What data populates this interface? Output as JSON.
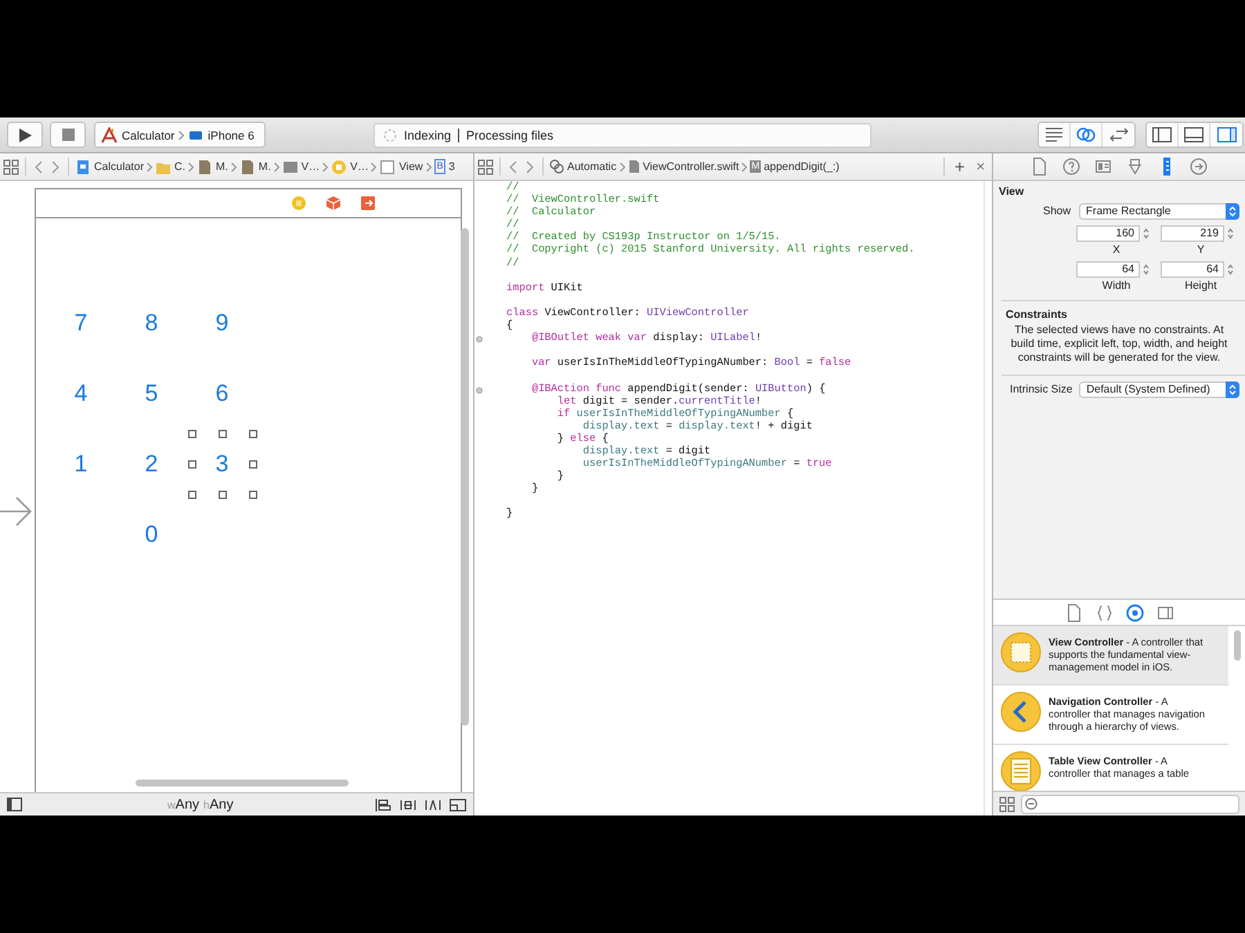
{
  "toolbar": {
    "scheme": {
      "project": "Calculator",
      "device": "iPhone 6"
    },
    "activity": {
      "status": "Indexing",
      "detail": "Processing files"
    },
    "editor_modes": [
      {
        "kind": "standard",
        "selected": false
      },
      {
        "kind": "assistant",
        "selected": true
      },
      {
        "kind": "version",
        "selected": false
      }
    ],
    "panels": [
      {
        "kind": "navigator",
        "on": false
      },
      {
        "kind": "debug",
        "on": false
      },
      {
        "kind": "utilities",
        "on": true
      }
    ]
  },
  "storyboard": {
    "jump_bar": [
      {
        "kind": "project",
        "label": "Calculator"
      },
      {
        "kind": "folder",
        "label": "C."
      },
      {
        "kind": "file",
        "label": "M."
      },
      {
        "kind": "file",
        "label": "M."
      },
      {
        "kind": "scene",
        "label": "V…"
      },
      {
        "kind": "controller",
        "label": "V…"
      },
      {
        "kind": "view",
        "label": "View"
      },
      {
        "kind": "button",
        "badge": "B",
        "label": "3"
      }
    ],
    "keypad": [
      [
        {
          "label": "7",
          "selected": false
        },
        {
          "label": "8",
          "selected": false
        },
        {
          "label": "9",
          "selected": false
        }
      ],
      [
        {
          "label": "4",
          "selected": false
        },
        {
          "label": "5",
          "selected": false
        },
        {
          "label": "6",
          "selected": false
        }
      ],
      [
        {
          "label": "1",
          "selected": false
        },
        {
          "label": "2",
          "selected": false
        },
        {
          "label": "3",
          "selected": true
        }
      ],
      [
        {
          "label": "0",
          "selected": false
        }
      ]
    ],
    "size_class": {
      "width_prefix": "w",
      "width": "Any",
      "height_prefix": "h",
      "height": "Any"
    }
  },
  "editor": {
    "jump_bar": {
      "mode": "Automatic",
      "file": "ViewController.swift",
      "symbol_badge": "M",
      "symbol": "appendDigit(_:)",
      "add": "+",
      "close": "×"
    },
    "lines": [
      {
        "kind": "code",
        "connection": false,
        "segments": [
          {
            "kind": "c",
            "text": "//"
          }
        ]
      },
      {
        "kind": "code",
        "connection": false,
        "segments": [
          {
            "kind": "c",
            "text": "//  ViewController.swift"
          }
        ]
      },
      {
        "kind": "code",
        "connection": false,
        "segments": [
          {
            "kind": "c",
            "text": "//  Calculator"
          }
        ]
      },
      {
        "kind": "code",
        "connection": false,
        "segments": [
          {
            "kind": "c",
            "text": "//"
          }
        ]
      },
      {
        "kind": "code",
        "connection": false,
        "segments": [
          {
            "kind": "c",
            "text": "//  Created by CS193p Instructor on 1/5/15."
          }
        ]
      },
      {
        "kind": "code",
        "connection": false,
        "segments": [
          {
            "kind": "c",
            "text": "//  Copyright (c) 2015 Stanford University. All rights reserved."
          }
        ]
      },
      {
        "kind": "code",
        "connection": false,
        "segments": [
          {
            "kind": "c",
            "text": "//"
          }
        ]
      },
      {
        "kind": "blank"
      },
      {
        "kind": "code",
        "connection": false,
        "segments": [
          {
            "kind": "k",
            "text": "import"
          },
          {
            "kind": "n",
            "text": " UIKit"
          }
        ]
      },
      {
        "kind": "blank"
      },
      {
        "kind": "code",
        "connection": false,
        "segments": [
          {
            "kind": "k",
            "text": "class"
          },
          {
            "kind": "n",
            "text": " ViewController: "
          },
          {
            "kind": "t",
            "text": "UIViewController"
          }
        ]
      },
      {
        "kind": "code",
        "connection": false,
        "segments": [
          {
            "kind": "n",
            "text": "{"
          }
        ]
      },
      {
        "kind": "code",
        "connection": true,
        "segments": [
          {
            "kind": "k",
            "text": "    @IBOutlet weak var"
          },
          {
            "kind": "n",
            "text": " display: "
          },
          {
            "kind": "t",
            "text": "UILabel"
          },
          {
            "kind": "n",
            "text": "!"
          }
        ]
      },
      {
        "kind": "blank"
      },
      {
        "kind": "code",
        "connection": false,
        "segments": [
          {
            "kind": "k",
            "text": "    var"
          },
          {
            "kind": "n",
            "text": " userIsInTheMiddleOfTypingANumber: "
          },
          {
            "kind": "t",
            "text": "Bool"
          },
          {
            "kind": "n",
            "text": " = "
          },
          {
            "kind": "k",
            "text": "false"
          }
        ]
      },
      {
        "kind": "blank"
      },
      {
        "kind": "code",
        "connection": true,
        "segments": [
          {
            "kind": "k",
            "text": "    @IBAction func"
          },
          {
            "kind": "n",
            "text": " appendDigit(sender: "
          },
          {
            "kind": "t",
            "text": "UIButton"
          },
          {
            "kind": "n",
            "text": ") {"
          }
        ]
      },
      {
        "kind": "code",
        "connection": false,
        "segments": [
          {
            "kind": "k",
            "text": "        let"
          },
          {
            "kind": "n",
            "text": " digit = sender."
          },
          {
            "kind": "t",
            "text": "currentTitle"
          },
          {
            "kind": "n",
            "text": "!"
          }
        ]
      },
      {
        "kind": "code",
        "connection": false,
        "segments": [
          {
            "kind": "k",
            "text": "        if"
          },
          {
            "kind": "p",
            "text": " userIsInTheMiddleOfTypingANumber"
          },
          {
            "kind": "n",
            "text": " {"
          }
        ]
      },
      {
        "kind": "code",
        "connection": false,
        "segments": [
          {
            "kind": "p",
            "text": "            display.text"
          },
          {
            "kind": "n",
            "text": " = "
          },
          {
            "kind": "p",
            "text": "display.text"
          },
          {
            "kind": "n",
            "text": "! + digit"
          }
        ]
      },
      {
        "kind": "code",
        "connection": false,
        "segments": [
          {
            "kind": "n",
            "text": "        } "
          },
          {
            "kind": "k",
            "text": "else"
          },
          {
            "kind": "n",
            "text": " {"
          }
        ]
      },
      {
        "kind": "code",
        "connection": false,
        "segments": [
          {
            "kind": "p",
            "text": "            display.text"
          },
          {
            "kind": "n",
            "text": " = digit"
          }
        ]
      },
      {
        "kind": "code",
        "connection": false,
        "segments": [
          {
            "kind": "p",
            "text": "            userIsInTheMiddleOfTypingANumber"
          },
          {
            "kind": "n",
            "text": " = "
          },
          {
            "kind": "k",
            "text": "true"
          }
        ]
      },
      {
        "kind": "code",
        "connection": false,
        "segments": [
          {
            "kind": "n",
            "text": "        }"
          }
        ]
      },
      {
        "kind": "code",
        "connection": false,
        "segments": [
          {
            "kind": "n",
            "text": "    }"
          }
        ]
      },
      {
        "kind": "blank"
      },
      {
        "kind": "code",
        "connection": false,
        "segments": [
          {
            "kind": "n",
            "text": "}"
          }
        ]
      }
    ]
  },
  "inspector": {
    "tabs": [
      {
        "kind": "file",
        "selected": false
      },
      {
        "kind": "help",
        "selected": false
      },
      {
        "kind": "identity",
        "selected": false
      },
      {
        "kind": "attributes",
        "selected": false
      },
      {
        "kind": "size",
        "selected": true
      },
      {
        "kind": "connections",
        "selected": false
      }
    ],
    "section": "View",
    "show_label": "Show",
    "show_value": "Frame Rectangle",
    "fields": [
      {
        "label": "X",
        "value": "160"
      },
      {
        "label": "Y",
        "value": "219"
      },
      {
        "label": "Width",
        "value": "64"
      },
      {
        "label": "Height",
        "value": "64"
      }
    ],
    "constraints_title": "Constraints",
    "constraints_text": "The selected views have no constraints. At build time, explicit left, top, width, and height constraints will be generated for the view.",
    "intrinsic_label": "Intrinsic Size",
    "intrinsic_value": "Default (System Defined)"
  },
  "library": {
    "tabs": [
      {
        "kind": "file",
        "selected": false
      },
      {
        "kind": "snippet",
        "selected": false
      },
      {
        "kind": "object",
        "selected": true
      },
      {
        "kind": "media",
        "selected": false
      }
    ],
    "items": [
      {
        "kind": "view-controller",
        "selected": true,
        "text": "**View Controller** - A controller that supports the fundamental view-management model in iOS."
      },
      {
        "kind": "navigation-controller",
        "selected": false,
        "text": "**Navigation Controller** - A controller that manages navigation through a hierarchy of views."
      },
      {
        "kind": "table-controller",
        "selected": false,
        "text": "**Table View Controller** - A controller that manages a table"
      }
    ]
  }
}
